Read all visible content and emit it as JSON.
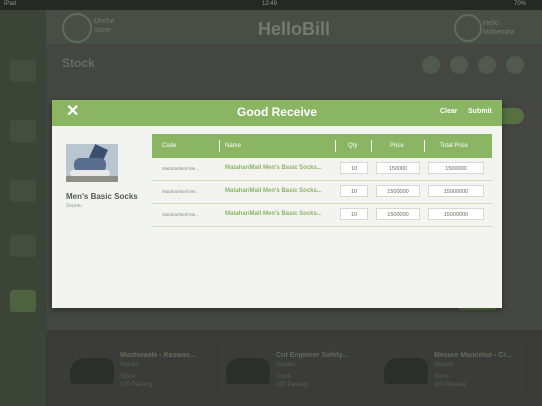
{
  "status": {
    "carrier": "iPad",
    "time": "12:49",
    "battery": "70%"
  },
  "topbar": {
    "store_line1": "Dhehe",
    "store_line2": "Store",
    "app_title": "HelloBill",
    "user_line1": "Hello",
    "user_line2": "Mahendra"
  },
  "page": {
    "title": "Stock"
  },
  "background_cards": [
    {
      "title": "Mustiwaale - Kaswas...",
      "line1": "Sepatu",
      "line2": "Stock",
      "line3": "100 Pasang"
    },
    {
      "title": "Cut Engineer Safety...",
      "line1": "Sepatu",
      "line2": "Stock",
      "line3": "100 Pasang"
    },
    {
      "title": "Mesure Mancelse - Cr...",
      "line1": "Sepatu",
      "line2": "Stock",
      "line3": "100 Pasang"
    }
  ],
  "modal": {
    "title": "Good Receive",
    "close_icon": "close-icon",
    "clear_label": "Clear",
    "submit_label": "Submit",
    "product": {
      "name": "Men's Basic Socks",
      "category": "Sepatu",
      "image_icon": "product-photo"
    },
    "table": {
      "headers": {
        "code": "Code",
        "name": "Name",
        "qty": "Qty",
        "price": "Price",
        "total": "Total Price"
      },
      "rows": [
        {
          "code": "MatahariMall Me...",
          "name": "MatahariMall Men's Basic Socks...",
          "qty": "10",
          "price": "150000",
          "total": "1500000"
        },
        {
          "code": "MatahariMall Me...",
          "name": "MatahariMall Men's Basic Socks...",
          "qty": "10",
          "price": "1500000",
          "total": "15000000"
        },
        {
          "code": "MatahariMall Me...",
          "name": "MatahariMall Men's Basic Socks...",
          "qty": "10",
          "price": "1500000",
          "total": "15000000"
        }
      ]
    }
  },
  "colors": {
    "accent": "#8ab562",
    "modal_bg": "#f3f4ef",
    "dim_bg": "#4a4d47"
  }
}
